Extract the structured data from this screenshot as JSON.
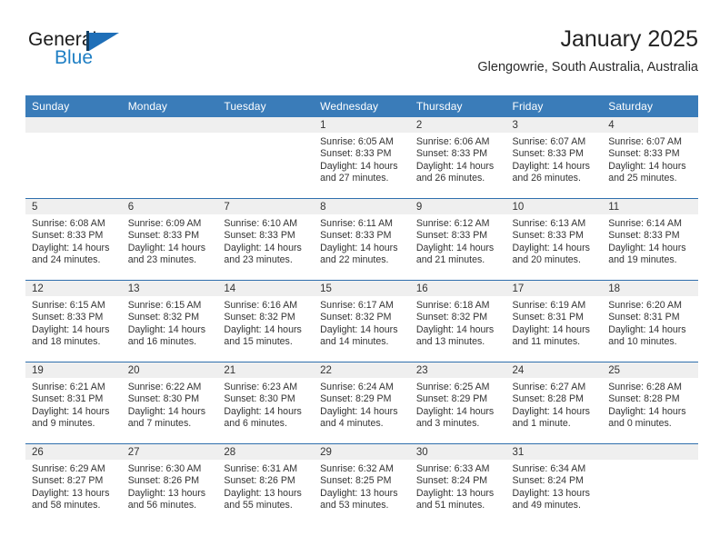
{
  "logo": {
    "word_one": "General",
    "word_two": "Blue",
    "triangle_icon": "blue-triangle-icon"
  },
  "header": {
    "title": "January 2025",
    "location": "Glengowrie, South Australia, Australia"
  },
  "calendar": {
    "weekday_headers": [
      "Sunday",
      "Monday",
      "Tuesday",
      "Wednesday",
      "Thursday",
      "Friday",
      "Saturday"
    ],
    "accent_color": "#3a7cb9",
    "band_color": "#efefef",
    "labels": {
      "sunrise": "Sunrise:",
      "sunset": "Sunset:",
      "daylight": "Daylight:"
    },
    "weeks": [
      [
        {
          "day": "",
          "empty": true
        },
        {
          "day": "",
          "empty": true
        },
        {
          "day": "",
          "empty": true
        },
        {
          "day": "1",
          "sunrise": "Sunrise: 6:05 AM",
          "sunset": "Sunset: 8:33 PM",
          "daylight": "Daylight: 14 hours and 27 minutes."
        },
        {
          "day": "2",
          "sunrise": "Sunrise: 6:06 AM",
          "sunset": "Sunset: 8:33 PM",
          "daylight": "Daylight: 14 hours and 26 minutes."
        },
        {
          "day": "3",
          "sunrise": "Sunrise: 6:07 AM",
          "sunset": "Sunset: 8:33 PM",
          "daylight": "Daylight: 14 hours and 26 minutes."
        },
        {
          "day": "4",
          "sunrise": "Sunrise: 6:07 AM",
          "sunset": "Sunset: 8:33 PM",
          "daylight": "Daylight: 14 hours and 25 minutes."
        }
      ],
      [
        {
          "day": "5",
          "sunrise": "Sunrise: 6:08 AM",
          "sunset": "Sunset: 8:33 PM",
          "daylight": "Daylight: 14 hours and 24 minutes."
        },
        {
          "day": "6",
          "sunrise": "Sunrise: 6:09 AM",
          "sunset": "Sunset: 8:33 PM",
          "daylight": "Daylight: 14 hours and 23 minutes."
        },
        {
          "day": "7",
          "sunrise": "Sunrise: 6:10 AM",
          "sunset": "Sunset: 8:33 PM",
          "daylight": "Daylight: 14 hours and 23 minutes."
        },
        {
          "day": "8",
          "sunrise": "Sunrise: 6:11 AM",
          "sunset": "Sunset: 8:33 PM",
          "daylight": "Daylight: 14 hours and 22 minutes."
        },
        {
          "day": "9",
          "sunrise": "Sunrise: 6:12 AM",
          "sunset": "Sunset: 8:33 PM",
          "daylight": "Daylight: 14 hours and 21 minutes."
        },
        {
          "day": "10",
          "sunrise": "Sunrise: 6:13 AM",
          "sunset": "Sunset: 8:33 PM",
          "daylight": "Daylight: 14 hours and 20 minutes."
        },
        {
          "day": "11",
          "sunrise": "Sunrise: 6:14 AM",
          "sunset": "Sunset: 8:33 PM",
          "daylight": "Daylight: 14 hours and 19 minutes."
        }
      ],
      [
        {
          "day": "12",
          "sunrise": "Sunrise: 6:15 AM",
          "sunset": "Sunset: 8:33 PM",
          "daylight": "Daylight: 14 hours and 18 minutes."
        },
        {
          "day": "13",
          "sunrise": "Sunrise: 6:15 AM",
          "sunset": "Sunset: 8:32 PM",
          "daylight": "Daylight: 14 hours and 16 minutes."
        },
        {
          "day": "14",
          "sunrise": "Sunrise: 6:16 AM",
          "sunset": "Sunset: 8:32 PM",
          "daylight": "Daylight: 14 hours and 15 minutes."
        },
        {
          "day": "15",
          "sunrise": "Sunrise: 6:17 AM",
          "sunset": "Sunset: 8:32 PM",
          "daylight": "Daylight: 14 hours and 14 minutes."
        },
        {
          "day": "16",
          "sunrise": "Sunrise: 6:18 AM",
          "sunset": "Sunset: 8:32 PM",
          "daylight": "Daylight: 14 hours and 13 minutes."
        },
        {
          "day": "17",
          "sunrise": "Sunrise: 6:19 AM",
          "sunset": "Sunset: 8:31 PM",
          "daylight": "Daylight: 14 hours and 11 minutes."
        },
        {
          "day": "18",
          "sunrise": "Sunrise: 6:20 AM",
          "sunset": "Sunset: 8:31 PM",
          "daylight": "Daylight: 14 hours and 10 minutes."
        }
      ],
      [
        {
          "day": "19",
          "sunrise": "Sunrise: 6:21 AM",
          "sunset": "Sunset: 8:31 PM",
          "daylight": "Daylight: 14 hours and 9 minutes."
        },
        {
          "day": "20",
          "sunrise": "Sunrise: 6:22 AM",
          "sunset": "Sunset: 8:30 PM",
          "daylight": "Daylight: 14 hours and 7 minutes."
        },
        {
          "day": "21",
          "sunrise": "Sunrise: 6:23 AM",
          "sunset": "Sunset: 8:30 PM",
          "daylight": "Daylight: 14 hours and 6 minutes."
        },
        {
          "day": "22",
          "sunrise": "Sunrise: 6:24 AM",
          "sunset": "Sunset: 8:29 PM",
          "daylight": "Daylight: 14 hours and 4 minutes."
        },
        {
          "day": "23",
          "sunrise": "Sunrise: 6:25 AM",
          "sunset": "Sunset: 8:29 PM",
          "daylight": "Daylight: 14 hours and 3 minutes."
        },
        {
          "day": "24",
          "sunrise": "Sunrise: 6:27 AM",
          "sunset": "Sunset: 8:28 PM",
          "daylight": "Daylight: 14 hours and 1 minute."
        },
        {
          "day": "25",
          "sunrise": "Sunrise: 6:28 AM",
          "sunset": "Sunset: 8:28 PM",
          "daylight": "Daylight: 14 hours and 0 minutes."
        }
      ],
      [
        {
          "day": "26",
          "sunrise": "Sunrise: 6:29 AM",
          "sunset": "Sunset: 8:27 PM",
          "daylight": "Daylight: 13 hours and 58 minutes."
        },
        {
          "day": "27",
          "sunrise": "Sunrise: 6:30 AM",
          "sunset": "Sunset: 8:26 PM",
          "daylight": "Daylight: 13 hours and 56 minutes."
        },
        {
          "day": "28",
          "sunrise": "Sunrise: 6:31 AM",
          "sunset": "Sunset: 8:26 PM",
          "daylight": "Daylight: 13 hours and 55 minutes."
        },
        {
          "day": "29",
          "sunrise": "Sunrise: 6:32 AM",
          "sunset": "Sunset: 8:25 PM",
          "daylight": "Daylight: 13 hours and 53 minutes."
        },
        {
          "day": "30",
          "sunrise": "Sunrise: 6:33 AM",
          "sunset": "Sunset: 8:24 PM",
          "daylight": "Daylight: 13 hours and 51 minutes."
        },
        {
          "day": "31",
          "sunrise": "Sunrise: 6:34 AM",
          "sunset": "Sunset: 8:24 PM",
          "daylight": "Daylight: 13 hours and 49 minutes."
        },
        {
          "day": "",
          "empty": true
        }
      ]
    ]
  }
}
